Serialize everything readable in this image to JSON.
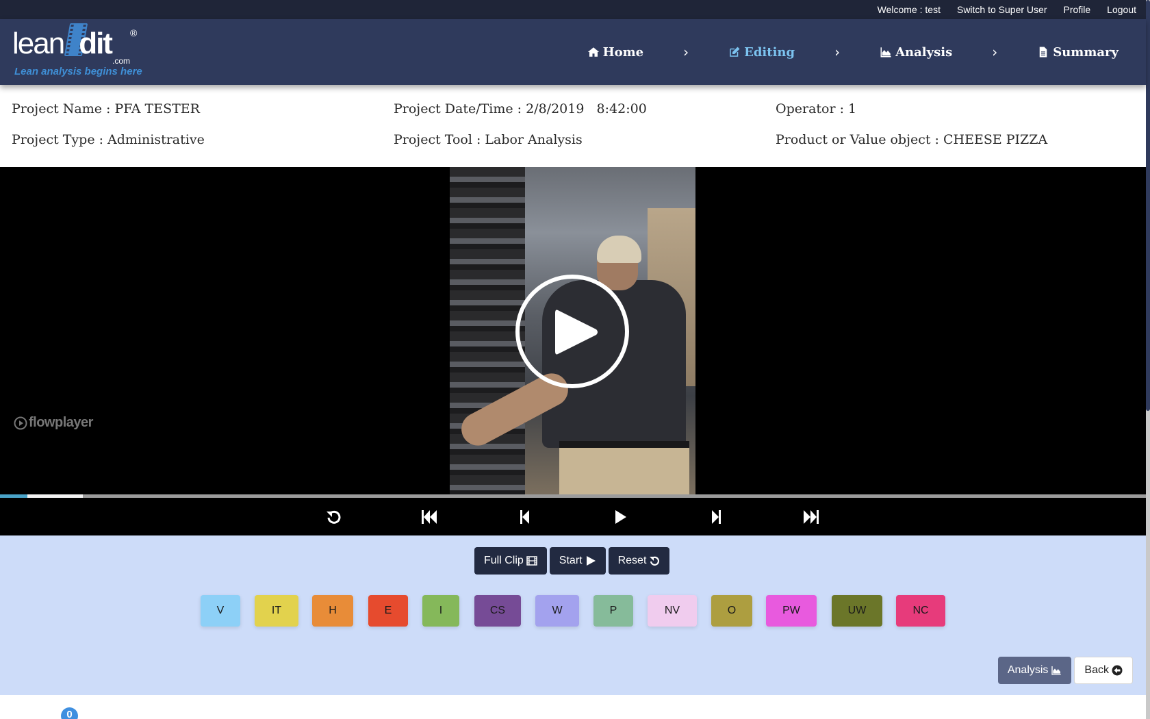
{
  "topbar": {
    "welcome": "Welcome : test",
    "switch_user": "Switch to Super User",
    "profile": "Profile",
    "logout": "Logout"
  },
  "logo": {
    "lean": "lean",
    "edit": "dit",
    "registered": "®",
    "com": ".com",
    "tagline": "Lean analysis begins here"
  },
  "nav": {
    "items": [
      {
        "label": "Home",
        "icon": "home-icon",
        "active": false
      },
      {
        "label": "Editing",
        "icon": "edit-icon",
        "active": true
      },
      {
        "label": "Analysis",
        "icon": "area-chart-icon",
        "active": false
      },
      {
        "label": "Summary",
        "icon": "document-icon",
        "active": false
      }
    ],
    "separator": "›"
  },
  "project": {
    "name": "Project Name : PFA TESTER",
    "date_time": "Project Date/Time : 2/8/2019   8:42:00",
    "operator": "Operator : 1",
    "type": "Project Type : Administrative",
    "tool": "Project Tool : Labor Analysis",
    "product": "Product or Value object : CHEESE PIZZA"
  },
  "player": {
    "brand": "flowplayer",
    "played_fraction": 0.024,
    "buffered_fraction": 0.072,
    "colors": {
      "played": "#4aa3c8",
      "buffered": "#f2f2f2",
      "track": "#9b9b9b"
    },
    "controls": [
      "replay-icon",
      "skip-to-start-icon",
      "step-back-icon",
      "play-icon",
      "step-forward-icon",
      "skip-to-end-icon"
    ]
  },
  "actions": {
    "full_clip": "Full Clip",
    "start": "Start",
    "reset": "Reset"
  },
  "categories": [
    {
      "code": "V",
      "color": "#8dd0f7"
    },
    {
      "code": "IT",
      "color": "#e2d24d"
    },
    {
      "code": "H",
      "color": "#e88c38"
    },
    {
      "code": "E",
      "color": "#e64b2e"
    },
    {
      "code": "I",
      "color": "#85b85a"
    },
    {
      "code": "CS",
      "color": "#764b96"
    },
    {
      "code": "W",
      "color": "#a3a2ee"
    },
    {
      "code": "P",
      "color": "#86bb9a"
    },
    {
      "code": "NV",
      "color": "#f0ccee"
    },
    {
      "code": "O",
      "color": "#ad9e40"
    },
    {
      "code": "PW",
      "color": "#e85ade"
    },
    {
      "code": "UW",
      "color": "#6b7629"
    },
    {
      "code": "NC",
      "color": "#e73b7b"
    }
  ],
  "bottom": {
    "analysis": "Analysis",
    "back": "Back"
  },
  "badge": {
    "count": "0"
  }
}
